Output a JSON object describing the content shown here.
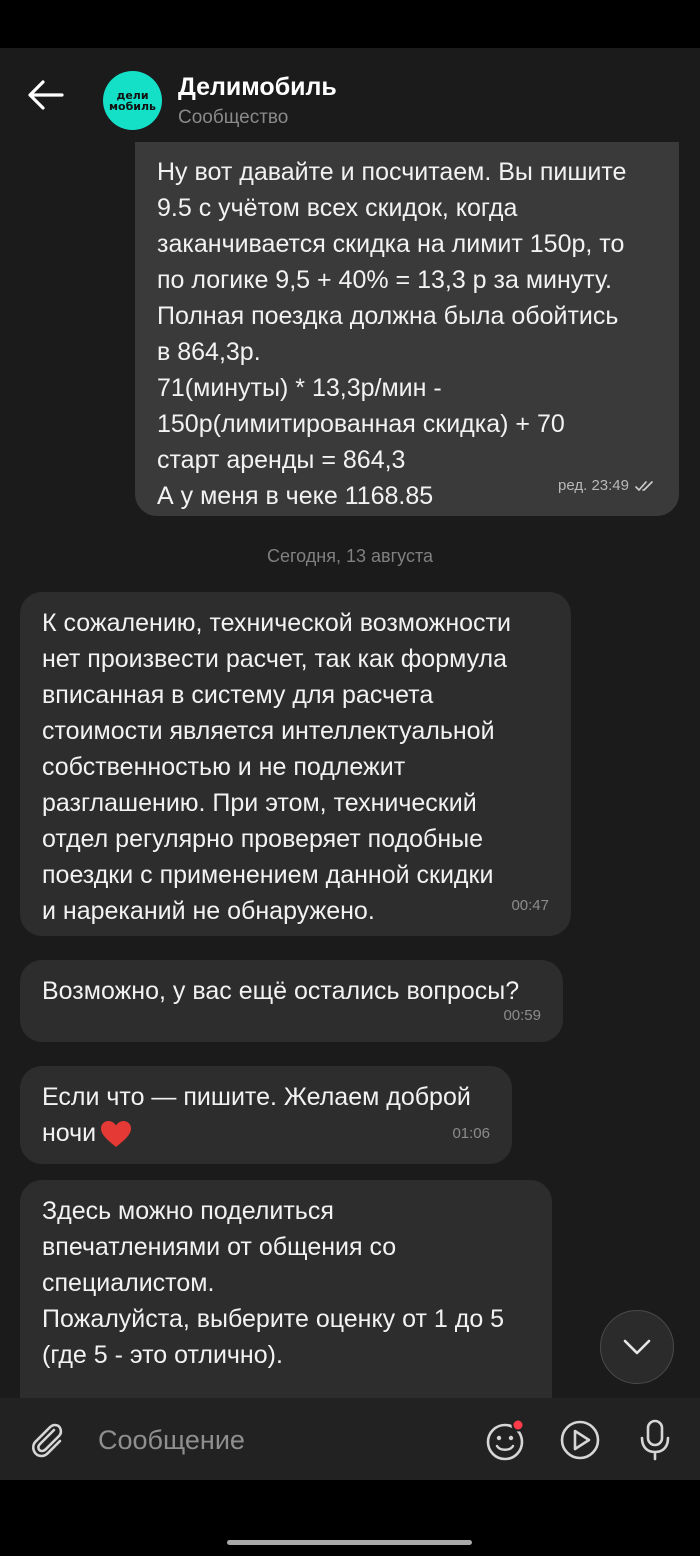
{
  "header": {
    "title": "Делимобиль",
    "subtitle": "Сообщество",
    "avatar_line1": "дели",
    "avatar_line2": "мобиль"
  },
  "messages": [
    {
      "direction": "outgoing",
      "text": "Ну вот давайте и посчитаем. Вы пишите\n9.5 с учётом всех скидок, когда\nзаканчивается скидка на лимит 150р, то\nпо логике 9,5 + 40% = 13,3 р за минуту.\nПолная поездка должна была обойтись\nв 864,3р.\n71(минуты) * 13,3р/мин -\n150р(лимитированная скидка) + 70\nстарт аренды = 864,3\nА у меня в чеке 1168.85",
      "time": "ред. 23:49",
      "status": "read"
    },
    {
      "direction": "incoming",
      "text": "К сожалению, технической возможности\nнет произвести расчет, так как формула\nвписанная в систему для расчета\nстоимости является интеллектуальной\nсобственностью и не подлежит\nразглашению. При этом, технический\nотдел регулярно проверяет подобные\nпоездки с применением данной скидки\nи нареканий не обнаружено.",
      "time": "00:47"
    },
    {
      "direction": "incoming",
      "text": "Возможно, у вас ещё остались вопросы?",
      "time": "00:59"
    },
    {
      "direction": "incoming",
      "text": "Если что — пишите. Желаем доброй\nночи",
      "time": "01:06"
    },
    {
      "direction": "incoming",
      "text": "Здесь можно поделиться\nвпечатлениями от общения со\nспециалистом.\nПожалуйста, выберите оценку от 1 до 5\n(где 5 - это отлично).",
      "time": ""
    }
  ],
  "date_separator": "Сегодня, 13 августа",
  "composer": {
    "placeholder": "Сообщение"
  },
  "colors": {
    "accent": "#14e0c8",
    "chat_bg": "#1b1b1b",
    "incoming_bubble": "#2d2d2d",
    "outgoing_bubble": "#3a3a3a",
    "heart": "#e53935",
    "notification_dot": "#ff3b4a"
  },
  "icons": {
    "back": "back-arrow-icon",
    "attach": "paperclip-icon",
    "emoji": "emoji-icon",
    "video": "play-circle-icon",
    "mic": "microphone-icon",
    "scroll": "chevron-down-icon",
    "read": "double-check-icon",
    "heart": "red-heart-icon"
  }
}
